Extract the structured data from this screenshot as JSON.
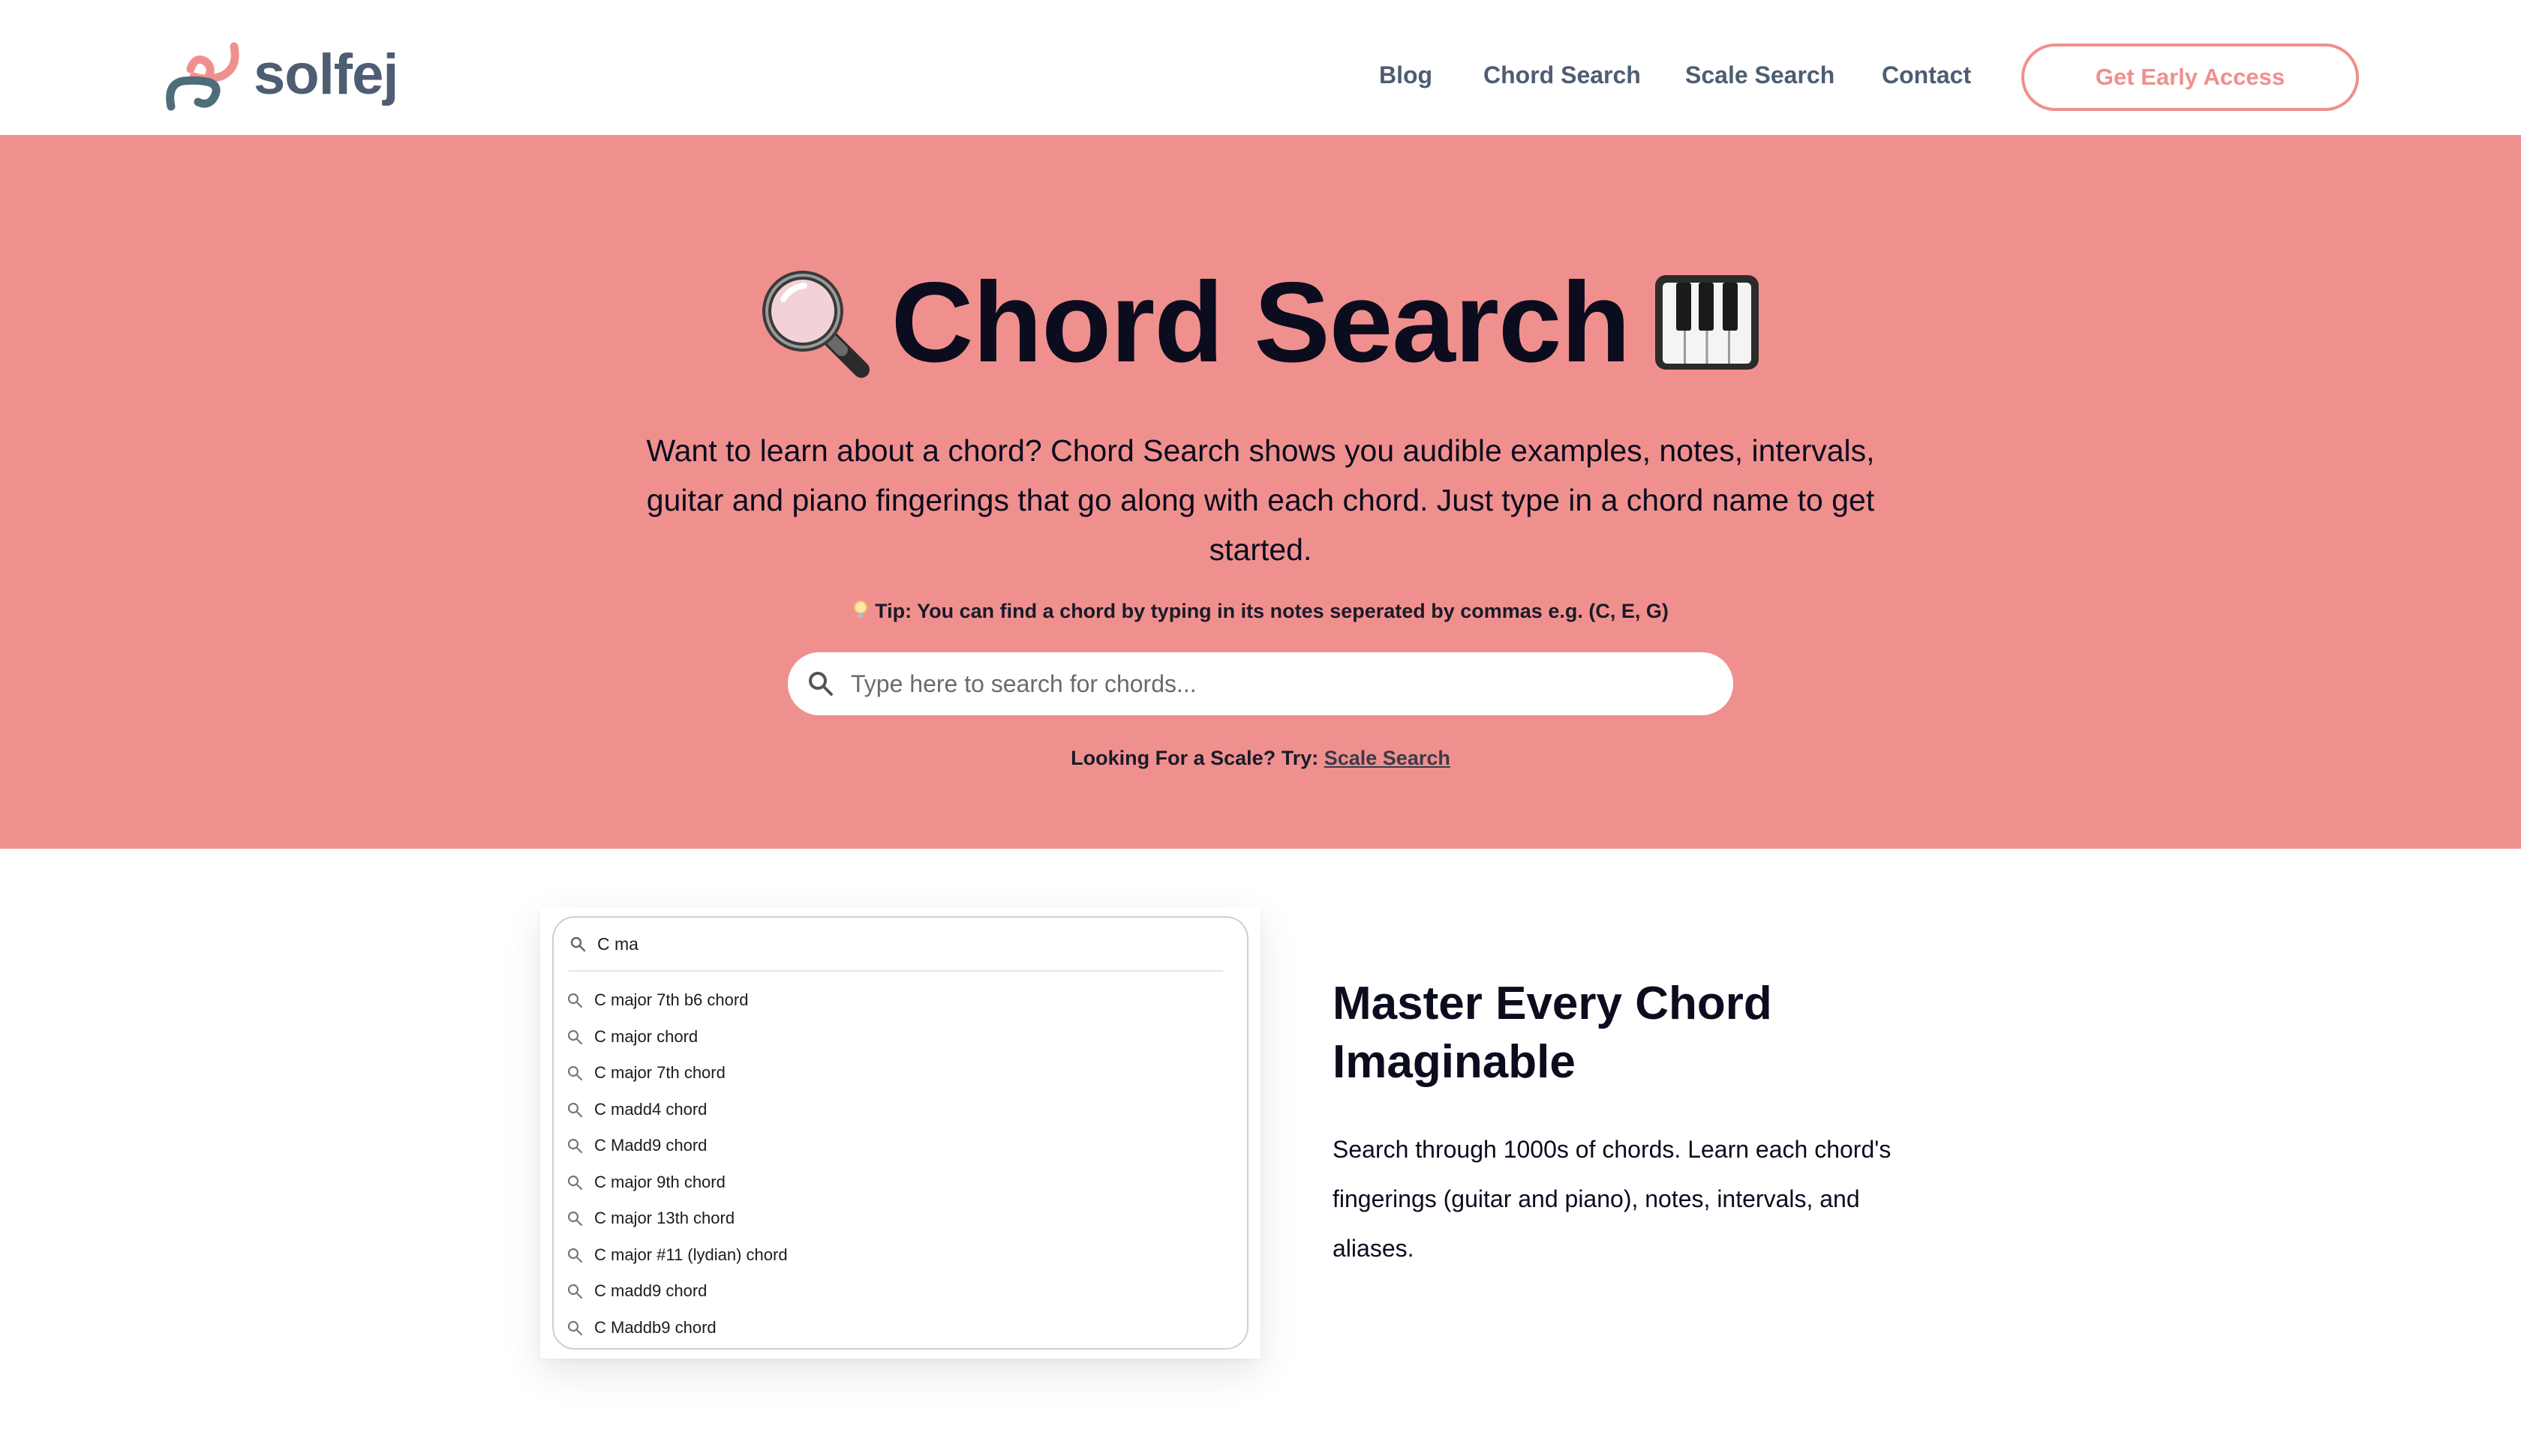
{
  "brand": {
    "name": "solfej"
  },
  "nav": {
    "items": [
      {
        "label": "Blog"
      },
      {
        "label": "Chord Search"
      },
      {
        "label": "Scale Search"
      },
      {
        "label": "Contact"
      }
    ],
    "cta_label": "Get Early Access"
  },
  "hero": {
    "title": "Chord Search",
    "title_icons": [
      "magnifying-glass-emoji",
      "piano-keys-emoji"
    ],
    "description": "Want to learn about a chord? Chord Search shows you audible examples, notes, intervals, guitar and piano fingerings that go along with each chord. Just type in a chord name to get started.",
    "tip": "Tip: You can find a chord by typing in its notes seperated by commas e.g. (C, E, G)",
    "search": {
      "placeholder": "Type here to search for chords...",
      "value": ""
    },
    "scale_prompt": "Looking For a Scale? Try:",
    "scale_link": "Scale Search"
  },
  "demo": {
    "query": "C ma",
    "suggestions": [
      "C major 7th b6 chord",
      "C major chord",
      "C major 7th chord",
      "C madd4 chord",
      "C Madd9 chord",
      "C major 9th chord",
      "C major 13th chord",
      "C major #11 (lydian) chord",
      "C madd9 chord",
      "C Maddb9 chord"
    ]
  },
  "feature": {
    "title": "Master Every Chord Imaginable",
    "text": "Search through 1000s of chords. Learn each chord's fingerings (guitar and piano), notes, intervals, and aliases."
  },
  "colors": {
    "hero_bg": "#f0908e",
    "accent": "#ef8f8d",
    "nav_text": "#4e5d72",
    "heading": "#0b0c1e"
  }
}
